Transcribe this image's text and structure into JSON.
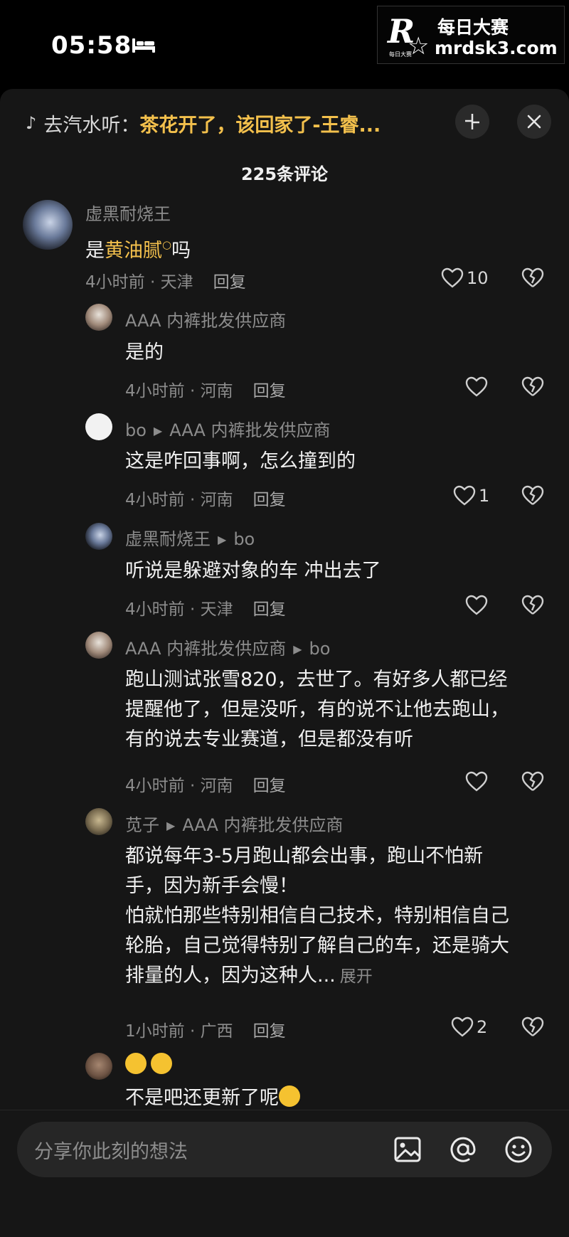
{
  "status_bar": {
    "time": "05:58"
  },
  "watermark": {
    "line1": "每日大赛",
    "line2": "mrdsk3.com",
    "logo_letter": "R",
    "logo_small": "每日大赛"
  },
  "music": {
    "prefix": "去汽水听：",
    "song": "茶花开了，该回家了-王睿..."
  },
  "comment_count": "225条评论",
  "comments": [
    {
      "user": "虚黑耐烧王",
      "text_before": "是",
      "text_highlight": "黄油腻",
      "text_after": "吗",
      "time": "4小时前 · 天津",
      "reply": "回复",
      "likes": "10"
    },
    {
      "user": "AAA 内裤批发供应商",
      "text": "是的",
      "time": "4小时前 · 河南",
      "reply": "回复",
      "likes": ""
    },
    {
      "user": "bo",
      "reply_to": "AAA 内裤批发供应商",
      "text": "这是咋回事啊，怎么撞到的",
      "time": "4小时前 · 河南",
      "reply": "回复",
      "likes": "1"
    },
    {
      "user": "虚黑耐烧王",
      "reply_to": "bo",
      "text": "听说是躲避对象的车  冲出去了",
      "time": "4小时前 · 天津",
      "reply": "回复",
      "likes": ""
    },
    {
      "user": "AAA 内裤批发供应商",
      "reply_to": "bo",
      "lines": [
        "跑山测试张雪820，去世了。有好多人都已经",
        "提醒他了，但是没听，有的说不让他去跑山，",
        "有的说去专业赛道，但是都没有听"
      ],
      "time": "4小时前 · 河南",
      "reply": "回复",
      "likes": ""
    },
    {
      "user": "苋子",
      "reply_to": "AAA 内裤批发供应商",
      "lines": [
        "都说每年3-5月跑山都会出事，跑山不怕新",
        "手，因为新手会慢！",
        "怕就怕那些特别相信自己技术，特别相信自己",
        "轮胎，自己觉得特别了解自己的车，还是骑大",
        "排量的人，因为这种人..."
      ],
      "expand": "展开",
      "time": "1小时前 · 广西",
      "reply": "回复",
      "likes": "2"
    },
    {
      "user": "",
      "text": "不是吧还更新了呢"
    }
  ],
  "input": {
    "placeholder": "分享你此刻的想法"
  },
  "colors": {
    "background": "#161616",
    "accent": "#f3c04c",
    "muted": "#8c8c8c"
  }
}
